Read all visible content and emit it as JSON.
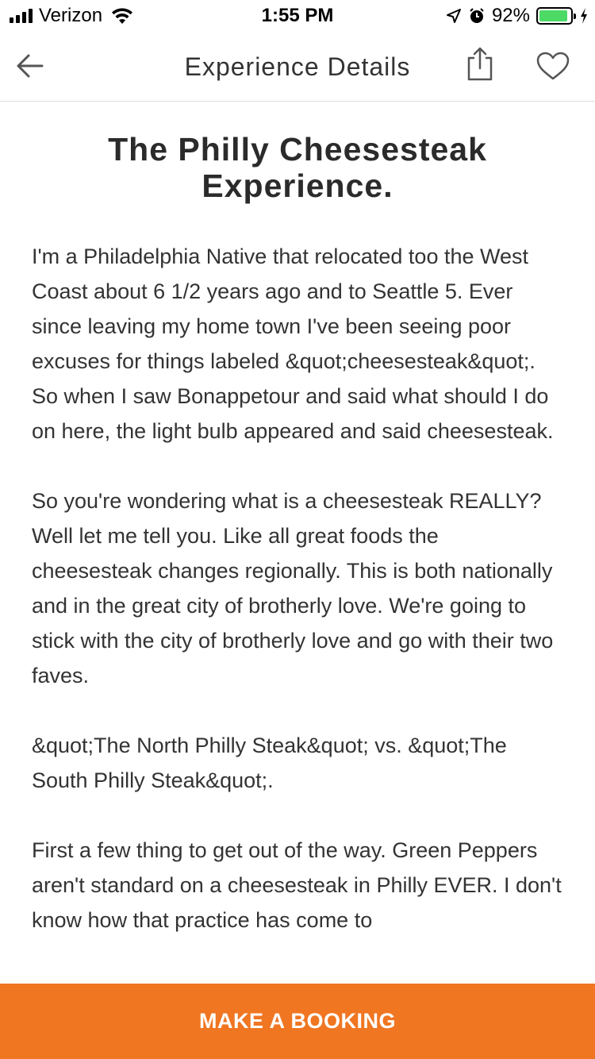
{
  "status_bar": {
    "carrier": "Verizon",
    "time": "1:55 PM",
    "battery_percent": "92%",
    "battery_level": 0.92,
    "icons": [
      "signal-icon",
      "wifi-icon",
      "location-arrow-icon",
      "alarm-icon",
      "battery-icon",
      "charging-icon"
    ],
    "battery_color": "#4cd964"
  },
  "nav": {
    "title": "Experience Details",
    "icons": [
      "back-arrow-icon",
      "share-icon",
      "heart-icon"
    ]
  },
  "experience": {
    "title": "The Philly Cheesesteak Experience.",
    "paragraphs": [
      "I'm a Philadelphia Native that relocated too the West Coast about 6 1/2 years ago and to Seattle 5. Ever since leaving my home town I've been seeing poor excuses for things labeled &quot;cheesesteak&quot;. So when I saw Bonappetour and said what should I do on here, the light bulb appeared and said cheesesteak.",
      "So you're wondering what is a cheesesteak REALLY? Well let me tell you. Like all great foods the cheesesteak changes regionally. This is both nationally and in the great city of brotherly love. We're going to stick with the city of brotherly love and go with their two faves.",
      "&quot;The North Philly Steak&quot; vs. &quot;The South Philly Steak&quot;.",
      "First a few thing to get out of the way.  Green Peppers aren't standard on a cheesesteak in Philly EVER. I don't know how that practice has come to"
    ]
  },
  "booking": {
    "label": "MAKE A BOOKING",
    "color": "#f07622"
  }
}
